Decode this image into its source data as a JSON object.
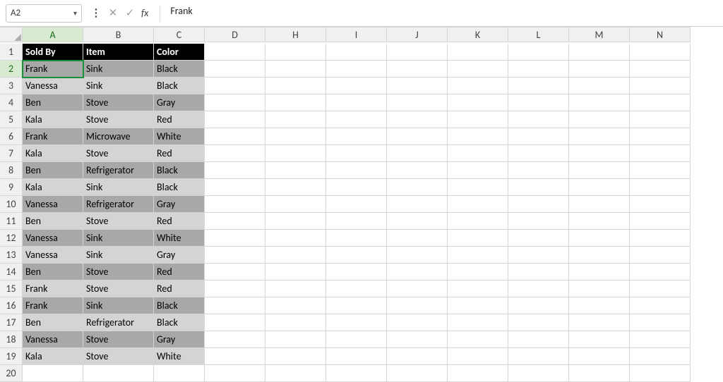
{
  "formula_bar": {
    "name_box": "A2",
    "fx_label": "fx",
    "formula_value": "Frank"
  },
  "columns": [
    "A",
    "B",
    "C",
    "D",
    "H",
    "I",
    "J",
    "K",
    "L",
    "M",
    "N"
  ],
  "rows": [
    1,
    2,
    3,
    4,
    5,
    6,
    7,
    8,
    9,
    10,
    11,
    12,
    13,
    14,
    15,
    16,
    17,
    18,
    19,
    20
  ],
  "active_cell": {
    "col": "A",
    "row": 2
  },
  "table": {
    "headers": {
      "A": "Sold By",
      "B": "Item",
      "C": "Color"
    },
    "data": [
      {
        "row": 2,
        "band": "dark",
        "A": "Frank",
        "B": "Sink",
        "C": "Black"
      },
      {
        "row": 3,
        "band": "light",
        "A": "Vanessa",
        "B": "Sink",
        "C": "Black"
      },
      {
        "row": 4,
        "band": "dark",
        "A": "Ben",
        "B": "Stove",
        "C": "Gray"
      },
      {
        "row": 5,
        "band": "light",
        "A": "Kala",
        "B": "Stove",
        "C": "Red"
      },
      {
        "row": 6,
        "band": "dark",
        "A": "Frank",
        "B": "Microwave",
        "C": "White"
      },
      {
        "row": 7,
        "band": "light",
        "A": "Kala",
        "B": "Stove",
        "C": "Red"
      },
      {
        "row": 8,
        "band": "dark",
        "A": "Ben",
        "B": "Refrigerator",
        "C": "Black"
      },
      {
        "row": 9,
        "band": "light",
        "A": "Kala",
        "B": "Sink",
        "C": "Black"
      },
      {
        "row": 10,
        "band": "dark",
        "A": "Vanessa",
        "B": "Refrigerator",
        "C": "Gray"
      },
      {
        "row": 11,
        "band": "light",
        "A": "Ben",
        "B": "Stove",
        "C": "Red"
      },
      {
        "row": 12,
        "band": "dark",
        "A": "Vanessa",
        "B": "Sink",
        "C": "White"
      },
      {
        "row": 13,
        "band": "light",
        "A": "Vanessa",
        "B": "Sink",
        "C": "Gray"
      },
      {
        "row": 14,
        "band": "dark",
        "A": "Ben",
        "B": "Stove",
        "C": "Red"
      },
      {
        "row": 15,
        "band": "light",
        "A": "Frank",
        "B": "Stove",
        "C": "Red"
      },
      {
        "row": 16,
        "band": "dark",
        "A": "Frank",
        "B": "Sink",
        "C": "Black"
      },
      {
        "row": 17,
        "band": "light",
        "A": "Ben",
        "B": "Refrigerator",
        "C": "Black"
      },
      {
        "row": 18,
        "band": "dark",
        "A": "Vanessa",
        "B": "Stove",
        "C": "Gray"
      },
      {
        "row": 19,
        "band": "light",
        "A": "Kala",
        "B": "Stove",
        "C": "White"
      }
    ]
  }
}
